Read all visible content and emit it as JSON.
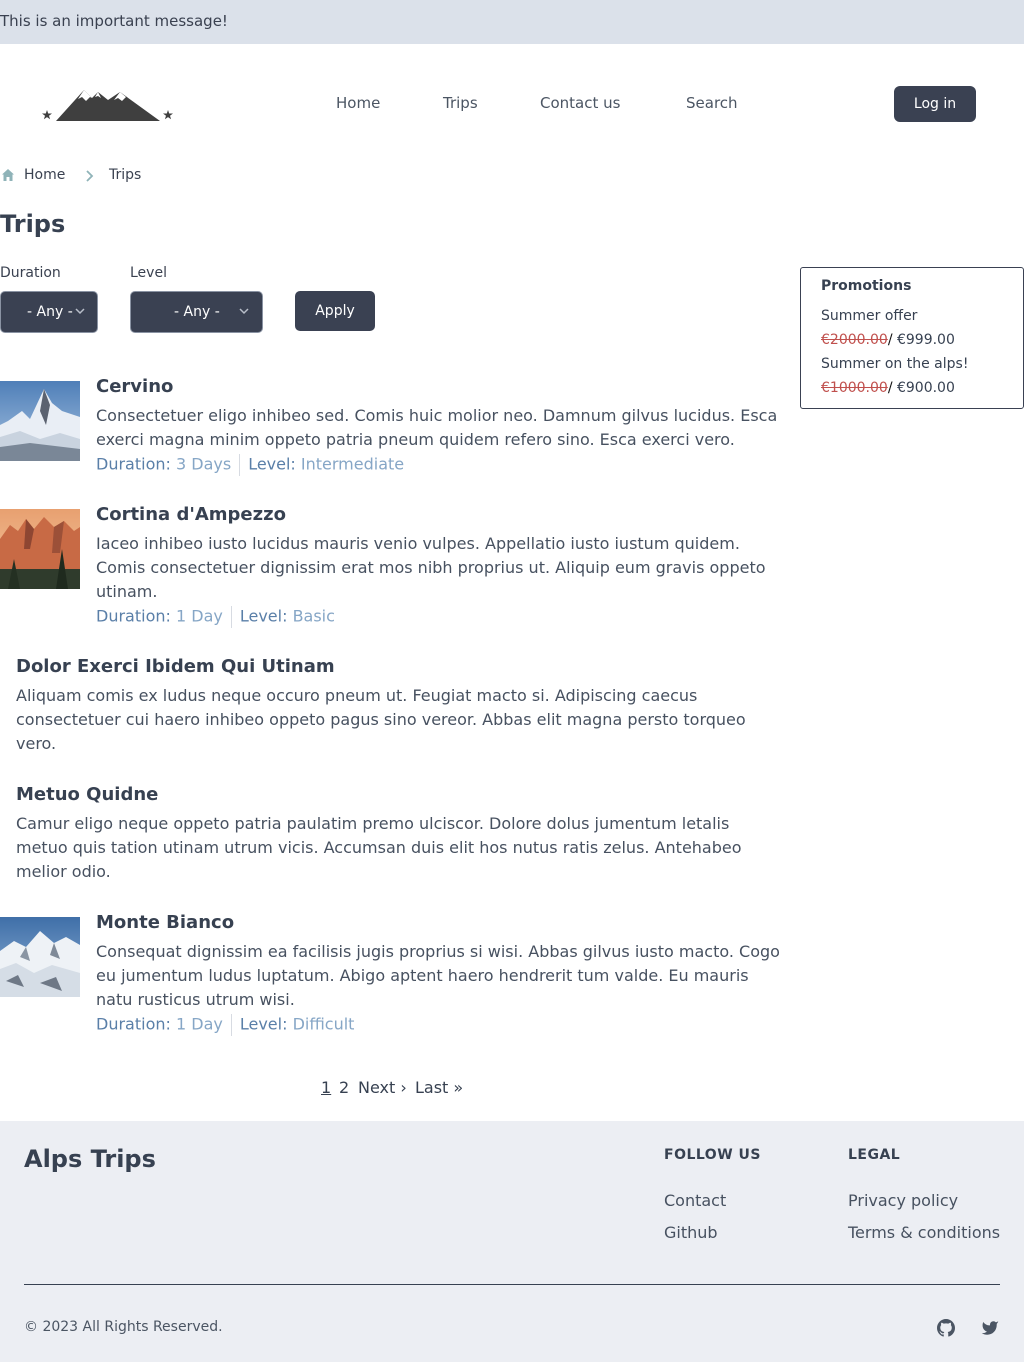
{
  "banner": {
    "message": "This is an important message!"
  },
  "header": {
    "nav": [
      "Home",
      "Trips",
      "Contact us",
      "Search"
    ],
    "login_label": "Log in"
  },
  "breadcrumb": {
    "home": "Home",
    "current": "Trips"
  },
  "page": {
    "title": "Trips"
  },
  "filters": {
    "duration_label": "Duration",
    "duration_value": "- Any -",
    "level_label": "Level",
    "level_value": "- Any -",
    "apply_label": "Apply"
  },
  "promotions": {
    "title": "Promotions",
    "items": [
      {
        "name": "Summer offer",
        "old_price": "€2000.00",
        "slash": "/",
        "new_price": " €999.00"
      },
      {
        "name": "Summer on the alps!",
        "old_price": "€1000.00",
        "slash": "/",
        "new_price": " €900.00"
      }
    ]
  },
  "trips": [
    {
      "title": "Cervino",
      "image": "matterhorn-photo",
      "description": "Consectetuer eligo inhibeo sed. Comis huic molior neo. Damnum gilvus lucidus. Esca exerci magna minim oppeto patria pneum quidem refero sino. Esca exerci vero.",
      "duration_label": "Duration:",
      "duration": "3 Days",
      "level_label": "Level:",
      "level": "Intermediate"
    },
    {
      "title": "Cortina d'Ampezzo",
      "image": "dolomites-photo",
      "description": "Iaceo inhibeo iusto lucidus mauris venio vulpes. Appellatio iusto iustum quidem. Comis consectetuer dignissim erat mos nibh proprius ut. Aliquip eum gravis oppeto utinam.",
      "duration_label": "Duration:",
      "duration": "1 Day",
      "level_label": "Level:",
      "level": "Basic"
    },
    {
      "title": "Dolor Exerci Ibidem Qui Utinam",
      "description": "Aliquam comis ex ludus neque occuro pneum ut. Feugiat macto si. Adipiscing caecus consectetuer cui haero inhibeo oppeto pagus sino vereor. Abbas elit magna persto torqueo vero."
    },
    {
      "title": "Metuo Quidne",
      "description": "Camur eligo neque oppeto patria paulatim premo ulciscor. Dolore dolus jumentum letalis metuo quis tation utinam utrum vicis. Accumsan duis elit hos nutus ratis zelus. Antehabeo melior odio."
    },
    {
      "title": "Monte Bianco",
      "image": "mont-blanc-photo",
      "description": "Consequat dignissim ea facilisis jugis proprius si wisi. Abbas gilvus iusto macto. Cogo eu jumentum ludus luptatum. Abigo aptent haero hendrerit tum valde. Eu mauris natu rusticus utrum wisi.",
      "duration_label": "Duration:",
      "duration": "1 Day",
      "level_label": "Level:",
      "level": "Difficult"
    }
  ],
  "pager": {
    "current": "1",
    "page2": "2",
    "next": "Next ›",
    "last": "Last »"
  },
  "footer": {
    "brand": "Alps Trips",
    "follow_heading": "FOLLOW US",
    "follow_links": [
      "Contact",
      "Github"
    ],
    "legal_heading": "LEGAL",
    "legal_links": [
      "Privacy policy",
      "Terms & conditions"
    ],
    "copyright": "© 2023 All Rights Reserved.",
    "social_icons": [
      "github-icon",
      "twitter-icon"
    ]
  },
  "colors": {
    "accent": "#3a4152",
    "banner_bg": "#dbe1ea",
    "footer_bg": "#eceef3",
    "meta_value": "#86a6c6",
    "old_price": "#c0504d"
  }
}
